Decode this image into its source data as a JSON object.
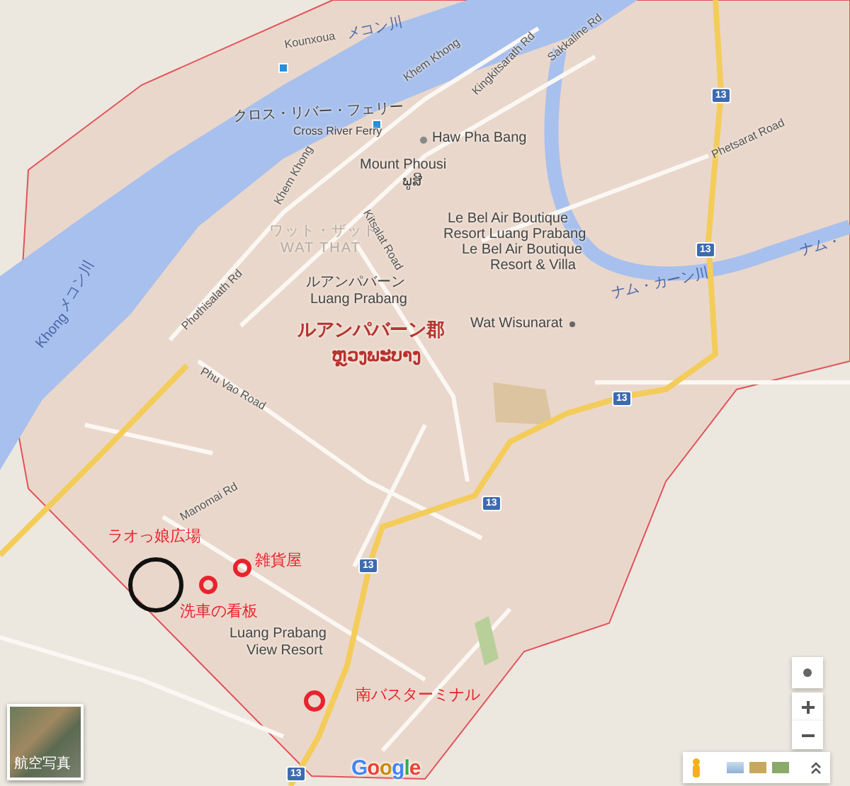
{
  "map": {
    "labels": [
      {
        "text": "メコン川",
        "kind": "water"
      },
      {
        "text": "Kounxoua",
        "kind": "street"
      },
      {
        "text": "Sakkaline Rd",
        "kind": "street"
      },
      {
        "text": "Khem Khong",
        "kind": "street"
      },
      {
        "text": "Kingkitsarath Rd",
        "kind": "street"
      },
      {
        "text": "クロス・リバー・フェリー",
        "kind": "poi"
      },
      {
        "text": "Cross River Ferry",
        "kind": "small"
      },
      {
        "text": "Haw Pha Bang",
        "kind": "poi"
      },
      {
        "text": "Mount Phousi",
        "kind": "poi"
      },
      {
        "text": "ພູສີ",
        "kind": "poi"
      },
      {
        "text": "Phetsarat Road",
        "kind": "street"
      },
      {
        "text": "Khem Khong",
        "kind": "street"
      },
      {
        "text": "Kitsalat Road",
        "kind": "street"
      },
      {
        "text": "ワット・ザット",
        "kind": "faded"
      },
      {
        "text": "WAT THAT",
        "kind": "faded"
      },
      {
        "text": "Le Bel Air Boutique",
        "kind": "poi"
      },
      {
        "text": "Resort Luang Prabang",
        "kind": "poi"
      },
      {
        "text": "Le Bel Air Boutique",
        "kind": "poi"
      },
      {
        "text": "Resort & Villa",
        "kind": "poi"
      },
      {
        "text": "ナム・",
        "kind": "water"
      },
      {
        "text": "ナム・カーン川",
        "kind": "water"
      },
      {
        "text": "ルアンパバーン",
        "kind": "poi"
      },
      {
        "text": "Luang Prabang",
        "kind": "poi"
      },
      {
        "text": "Wat Wisunarat",
        "kind": "poi"
      },
      {
        "text": "ルアンパバーン郡",
        "kind": "district"
      },
      {
        "text": "ຫຼວງພະບາງ",
        "kind": "district"
      },
      {
        "text": "メコン川",
        "kind": "water"
      },
      {
        "text": "Khong",
        "kind": "water"
      },
      {
        "text": "Phothisalath Rd",
        "kind": "street"
      },
      {
        "text": "Phu Vao Road",
        "kind": "street"
      },
      {
        "text": "Manomai Rd",
        "kind": "street"
      },
      {
        "text": "ラオっ娘広場",
        "kind": "annotation"
      },
      {
        "text": "雑貨屋",
        "kind": "annotation"
      },
      {
        "text": "洗車の看板",
        "kind": "annotation"
      },
      {
        "text": "Luang Prabang",
        "kind": "poi"
      },
      {
        "text": "View Resort",
        "kind": "poi"
      },
      {
        "text": "南バスターミナル",
        "kind": "annotation"
      }
    ],
    "route_shields": [
      "13",
      "13",
      "13",
      "13",
      "13",
      "13"
    ],
    "logo": "Google",
    "satellite_toggle": {
      "label": "航空写真"
    }
  }
}
